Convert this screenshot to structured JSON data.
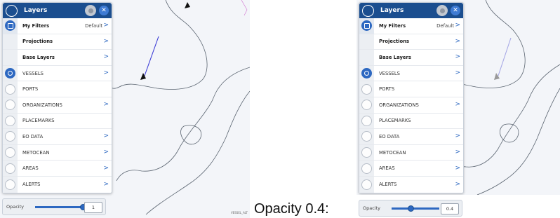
{
  "panel": {
    "title": "Layers",
    "rows": [
      {
        "label": "My Filters",
        "value": "Default",
        "chevron": ">",
        "style": "bold"
      },
      {
        "label": "Projections",
        "value": "",
        "chevron": ">",
        "style": "bold"
      },
      {
        "label": "Base Layers",
        "value": "",
        "chevron": ">",
        "style": "bold"
      },
      {
        "label": "VESSELS",
        "value": "",
        "chevron": ">",
        "style": "normal"
      },
      {
        "label": "PORTS",
        "value": "",
        "chevron": "",
        "style": "normal"
      },
      {
        "label": "ORGANIZATIONS",
        "value": "",
        "chevron": ">",
        "style": "normal"
      },
      {
        "label": "PLACEMARKS",
        "value": "",
        "chevron": "",
        "style": "normal"
      },
      {
        "label": "EO DATA",
        "value": "",
        "chevron": ">",
        "style": "normal"
      },
      {
        "label": "METOCEAN",
        "value": "",
        "chevron": ">",
        "style": "normal"
      },
      {
        "label": "AREAS",
        "value": "",
        "chevron": ">",
        "style": "normal"
      },
      {
        "label": "ALERTS",
        "value": "",
        "chevron": ">",
        "style": "normal"
      }
    ],
    "active_layer": "VESSELS"
  },
  "left_view": {
    "opacity_label": "Opacity",
    "opacity_value": "1",
    "opacity_fraction": 1.0
  },
  "right_view": {
    "opacity_label": "Opacity",
    "opacity_value": "0.4",
    "opacity_fraction": 0.4
  },
  "caption": {
    "text": "Opacity 0.4:",
    "small_prefix": "VESSEL_ALT"
  },
  "icons": {
    "header_toggle": "circle-toggle-icon",
    "settings": "gear-icon",
    "close": "close-icon",
    "filter": "filter-icon",
    "layer_radio": "radio-icon",
    "chevron": "chevron-right-icon",
    "vessel_marker": "vessel-arrow-icon"
  },
  "colors": {
    "header": "#1b4e8f",
    "accent": "#2d68c1",
    "map_bg": "#f3f5f9",
    "coast": "#5a6470",
    "vessel_track": "#3b3bd6",
    "route_pink": "#d070d0"
  }
}
